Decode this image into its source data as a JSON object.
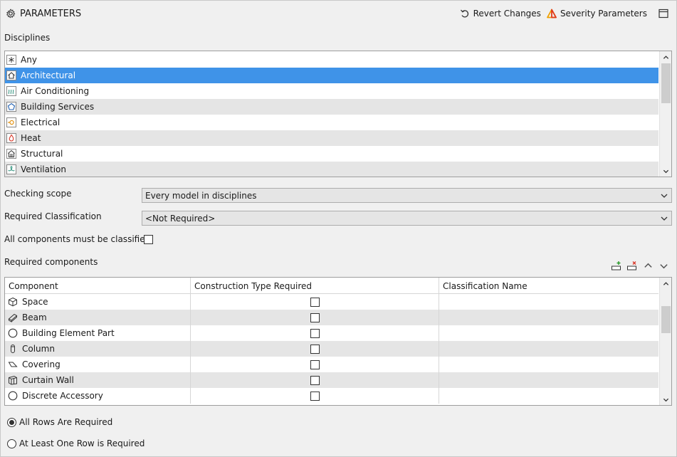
{
  "header": {
    "title": "PARAMETERS",
    "title_icon": "gear-icon",
    "revert_label": "Revert Changes",
    "severity_label": "Severity Parameters",
    "accent_color": "#f0a000"
  },
  "disciplines": {
    "label": "Disciplines",
    "items": [
      {
        "label": "Any",
        "icon": "asterisk-icon"
      },
      {
        "label": "Architectural",
        "icon": "house-icon",
        "selected": true
      },
      {
        "label": "Air Conditioning",
        "icon": "air-conditioning-icon"
      },
      {
        "label": "Building Services",
        "icon": "pentagon-icon"
      },
      {
        "label": "Electrical",
        "icon": "electrical-icon"
      },
      {
        "label": "Heat",
        "icon": "flame-icon"
      },
      {
        "label": "Structural",
        "icon": "structural-icon"
      },
      {
        "label": "Ventilation",
        "icon": "fan-icon"
      }
    ],
    "selection_color": "#3f93e8"
  },
  "checking_scope": {
    "label": "Checking scope",
    "value": "Every model in disciplines"
  },
  "required_classification": {
    "label": "Required Classification",
    "value": "<Not Required>"
  },
  "all_classified": {
    "label": "All components must be classified",
    "checked": false
  },
  "required_components": {
    "label": "Required components",
    "columns": [
      "Component",
      "Construction Type Required",
      "Classification Name"
    ],
    "rows": [
      {
        "component": "Space",
        "icon": "cube-icon",
        "construction_required": false,
        "classification": ""
      },
      {
        "component": "Beam",
        "icon": "beam-icon",
        "construction_required": false,
        "classification": ""
      },
      {
        "component": "Building Element Part",
        "icon": "circle-icon",
        "construction_required": false,
        "classification": ""
      },
      {
        "component": "Column",
        "icon": "column-icon",
        "construction_required": false,
        "classification": ""
      },
      {
        "component": "Covering",
        "icon": "covering-icon",
        "construction_required": false,
        "classification": ""
      },
      {
        "component": "Curtain Wall",
        "icon": "curtain-wall-icon",
        "construction_required": false,
        "classification": ""
      },
      {
        "component": "Discrete Accessory",
        "icon": "circle-icon",
        "construction_required": false,
        "classification": ""
      }
    ]
  },
  "requirement_mode": {
    "options": [
      "All Rows Are Required",
      "At Least One Row is Required"
    ],
    "selected": "All Rows Are Required"
  }
}
